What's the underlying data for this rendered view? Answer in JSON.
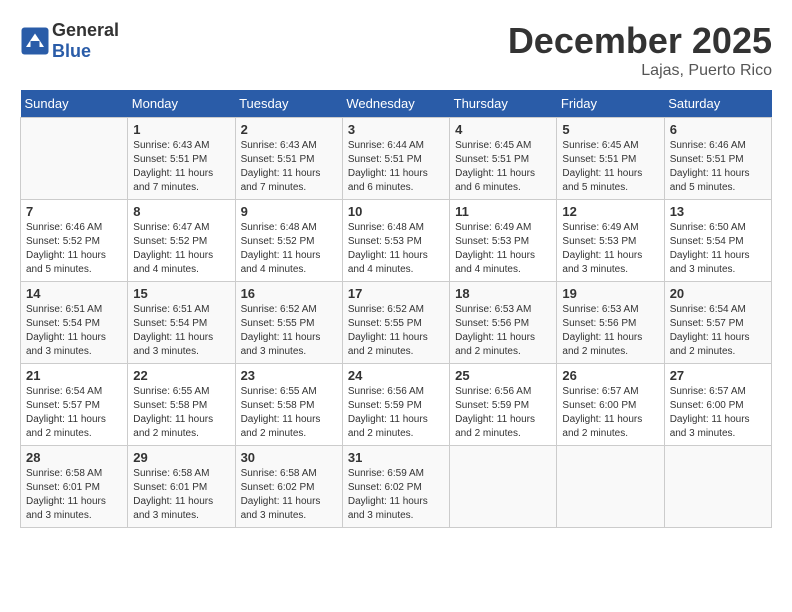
{
  "header": {
    "logo_line1": "General",
    "logo_line2": "Blue",
    "month": "December 2025",
    "location": "Lajas, Puerto Rico"
  },
  "weekdays": [
    "Sunday",
    "Monday",
    "Tuesday",
    "Wednesday",
    "Thursday",
    "Friday",
    "Saturday"
  ],
  "weeks": [
    [
      {
        "day": "",
        "info": ""
      },
      {
        "day": "1",
        "info": "Sunrise: 6:43 AM\nSunset: 5:51 PM\nDaylight: 11 hours\nand 7 minutes."
      },
      {
        "day": "2",
        "info": "Sunrise: 6:43 AM\nSunset: 5:51 PM\nDaylight: 11 hours\nand 7 minutes."
      },
      {
        "day": "3",
        "info": "Sunrise: 6:44 AM\nSunset: 5:51 PM\nDaylight: 11 hours\nand 6 minutes."
      },
      {
        "day": "4",
        "info": "Sunrise: 6:45 AM\nSunset: 5:51 PM\nDaylight: 11 hours\nand 6 minutes."
      },
      {
        "day": "5",
        "info": "Sunrise: 6:45 AM\nSunset: 5:51 PM\nDaylight: 11 hours\nand 5 minutes."
      },
      {
        "day": "6",
        "info": "Sunrise: 6:46 AM\nSunset: 5:51 PM\nDaylight: 11 hours\nand 5 minutes."
      }
    ],
    [
      {
        "day": "7",
        "info": "Sunrise: 6:46 AM\nSunset: 5:52 PM\nDaylight: 11 hours\nand 5 minutes."
      },
      {
        "day": "8",
        "info": "Sunrise: 6:47 AM\nSunset: 5:52 PM\nDaylight: 11 hours\nand 4 minutes."
      },
      {
        "day": "9",
        "info": "Sunrise: 6:48 AM\nSunset: 5:52 PM\nDaylight: 11 hours\nand 4 minutes."
      },
      {
        "day": "10",
        "info": "Sunrise: 6:48 AM\nSunset: 5:53 PM\nDaylight: 11 hours\nand 4 minutes."
      },
      {
        "day": "11",
        "info": "Sunrise: 6:49 AM\nSunset: 5:53 PM\nDaylight: 11 hours\nand 4 minutes."
      },
      {
        "day": "12",
        "info": "Sunrise: 6:49 AM\nSunset: 5:53 PM\nDaylight: 11 hours\nand 3 minutes."
      },
      {
        "day": "13",
        "info": "Sunrise: 6:50 AM\nSunset: 5:54 PM\nDaylight: 11 hours\nand 3 minutes."
      }
    ],
    [
      {
        "day": "14",
        "info": "Sunrise: 6:51 AM\nSunset: 5:54 PM\nDaylight: 11 hours\nand 3 minutes."
      },
      {
        "day": "15",
        "info": "Sunrise: 6:51 AM\nSunset: 5:54 PM\nDaylight: 11 hours\nand 3 minutes."
      },
      {
        "day": "16",
        "info": "Sunrise: 6:52 AM\nSunset: 5:55 PM\nDaylight: 11 hours\nand 3 minutes."
      },
      {
        "day": "17",
        "info": "Sunrise: 6:52 AM\nSunset: 5:55 PM\nDaylight: 11 hours\nand 2 minutes."
      },
      {
        "day": "18",
        "info": "Sunrise: 6:53 AM\nSunset: 5:56 PM\nDaylight: 11 hours\nand 2 minutes."
      },
      {
        "day": "19",
        "info": "Sunrise: 6:53 AM\nSunset: 5:56 PM\nDaylight: 11 hours\nand 2 minutes."
      },
      {
        "day": "20",
        "info": "Sunrise: 6:54 AM\nSunset: 5:57 PM\nDaylight: 11 hours\nand 2 minutes."
      }
    ],
    [
      {
        "day": "21",
        "info": "Sunrise: 6:54 AM\nSunset: 5:57 PM\nDaylight: 11 hours\nand 2 minutes."
      },
      {
        "day": "22",
        "info": "Sunrise: 6:55 AM\nSunset: 5:58 PM\nDaylight: 11 hours\nand 2 minutes."
      },
      {
        "day": "23",
        "info": "Sunrise: 6:55 AM\nSunset: 5:58 PM\nDaylight: 11 hours\nand 2 minutes."
      },
      {
        "day": "24",
        "info": "Sunrise: 6:56 AM\nSunset: 5:59 PM\nDaylight: 11 hours\nand 2 minutes."
      },
      {
        "day": "25",
        "info": "Sunrise: 6:56 AM\nSunset: 5:59 PM\nDaylight: 11 hours\nand 2 minutes."
      },
      {
        "day": "26",
        "info": "Sunrise: 6:57 AM\nSunset: 6:00 PM\nDaylight: 11 hours\nand 2 minutes."
      },
      {
        "day": "27",
        "info": "Sunrise: 6:57 AM\nSunset: 6:00 PM\nDaylight: 11 hours\nand 3 minutes."
      }
    ],
    [
      {
        "day": "28",
        "info": "Sunrise: 6:58 AM\nSunset: 6:01 PM\nDaylight: 11 hours\nand 3 minutes."
      },
      {
        "day": "29",
        "info": "Sunrise: 6:58 AM\nSunset: 6:01 PM\nDaylight: 11 hours\nand 3 minutes."
      },
      {
        "day": "30",
        "info": "Sunrise: 6:58 AM\nSunset: 6:02 PM\nDaylight: 11 hours\nand 3 minutes."
      },
      {
        "day": "31",
        "info": "Sunrise: 6:59 AM\nSunset: 6:02 PM\nDaylight: 11 hours\nand 3 minutes."
      },
      {
        "day": "",
        "info": ""
      },
      {
        "day": "",
        "info": ""
      },
      {
        "day": "",
        "info": ""
      }
    ]
  ]
}
